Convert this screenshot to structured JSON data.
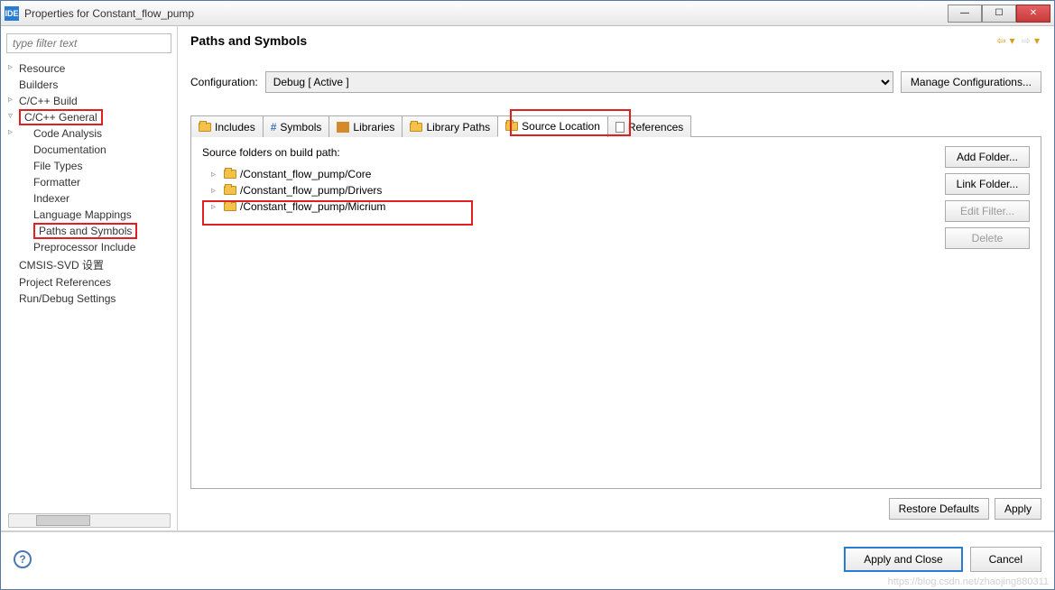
{
  "window": {
    "title": "Properties for Constant_flow_pump",
    "ide_badge": "IDE"
  },
  "filter_placeholder": "type filter text",
  "tree": {
    "resource": "Resource",
    "builders": "Builders",
    "ccbuild": "C/C++ Build",
    "ccgeneral": "C/C++ General",
    "code_analysis": "Code Analysis",
    "documentation": "Documentation",
    "file_types": "File Types",
    "formatter": "Formatter",
    "indexer": "Indexer",
    "lang_mappings": "Language Mappings",
    "paths_symbols": "Paths and Symbols",
    "preprocessor": "Preprocessor Include",
    "cmsis": "CMSIS-SVD 设置",
    "proj_refs": "Project References",
    "run_debug": "Run/Debug Settings"
  },
  "page": {
    "title": "Paths and Symbols",
    "config_label": "Configuration:",
    "config_value": "Debug  [ Active ]",
    "manage_btn": "Manage Configurations..."
  },
  "tabs": {
    "includes": "Includes",
    "symbols": "Symbols",
    "libraries": "Libraries",
    "library_paths": "Library Paths",
    "source_location": "Source Location",
    "references": "References"
  },
  "content": {
    "heading": "Source folders on build path:",
    "items": [
      "/Constant_flow_pump/Core",
      "/Constant_flow_pump/Drivers",
      "/Constant_flow_pump/Micrium"
    ]
  },
  "side_buttons": {
    "add": "Add Folder...",
    "link": "Link Folder...",
    "edit": "Edit Filter...",
    "delete": "Delete"
  },
  "footer": {
    "restore": "Restore Defaults",
    "apply": "Apply"
  },
  "bottom": {
    "apply_close": "Apply and Close",
    "cancel": "Cancel"
  },
  "watermark": "https://blog.csdn.net/zhaojing880311"
}
